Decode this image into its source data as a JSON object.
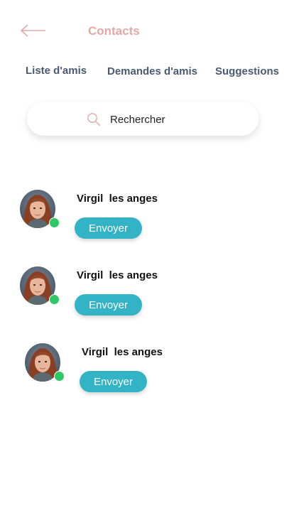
{
  "header": {
    "back_icon": "arrow-left-icon",
    "title": "Contacts",
    "accent_color": "#e3a8a6"
  },
  "tabs": [
    {
      "label": "Liste d'amis"
    },
    {
      "label": "Demandes d'amis"
    },
    {
      "label": "Suggestions"
    }
  ],
  "search": {
    "icon": "search-icon",
    "placeholder": "Rechercher",
    "value": ""
  },
  "contacts": [
    {
      "name": "Virgil  les anges",
      "status": "online",
      "action_label": "Envoyer"
    },
    {
      "name": "Virgil  les anges",
      "status": "online",
      "action_label": "Envoyer"
    },
    {
      "name": "Virgil  les anges",
      "status": "online",
      "action_label": "Envoyer"
    }
  ],
  "colors": {
    "button": "#33b4c6",
    "online": "#2ec866",
    "tab_text": "#4a5a73"
  }
}
